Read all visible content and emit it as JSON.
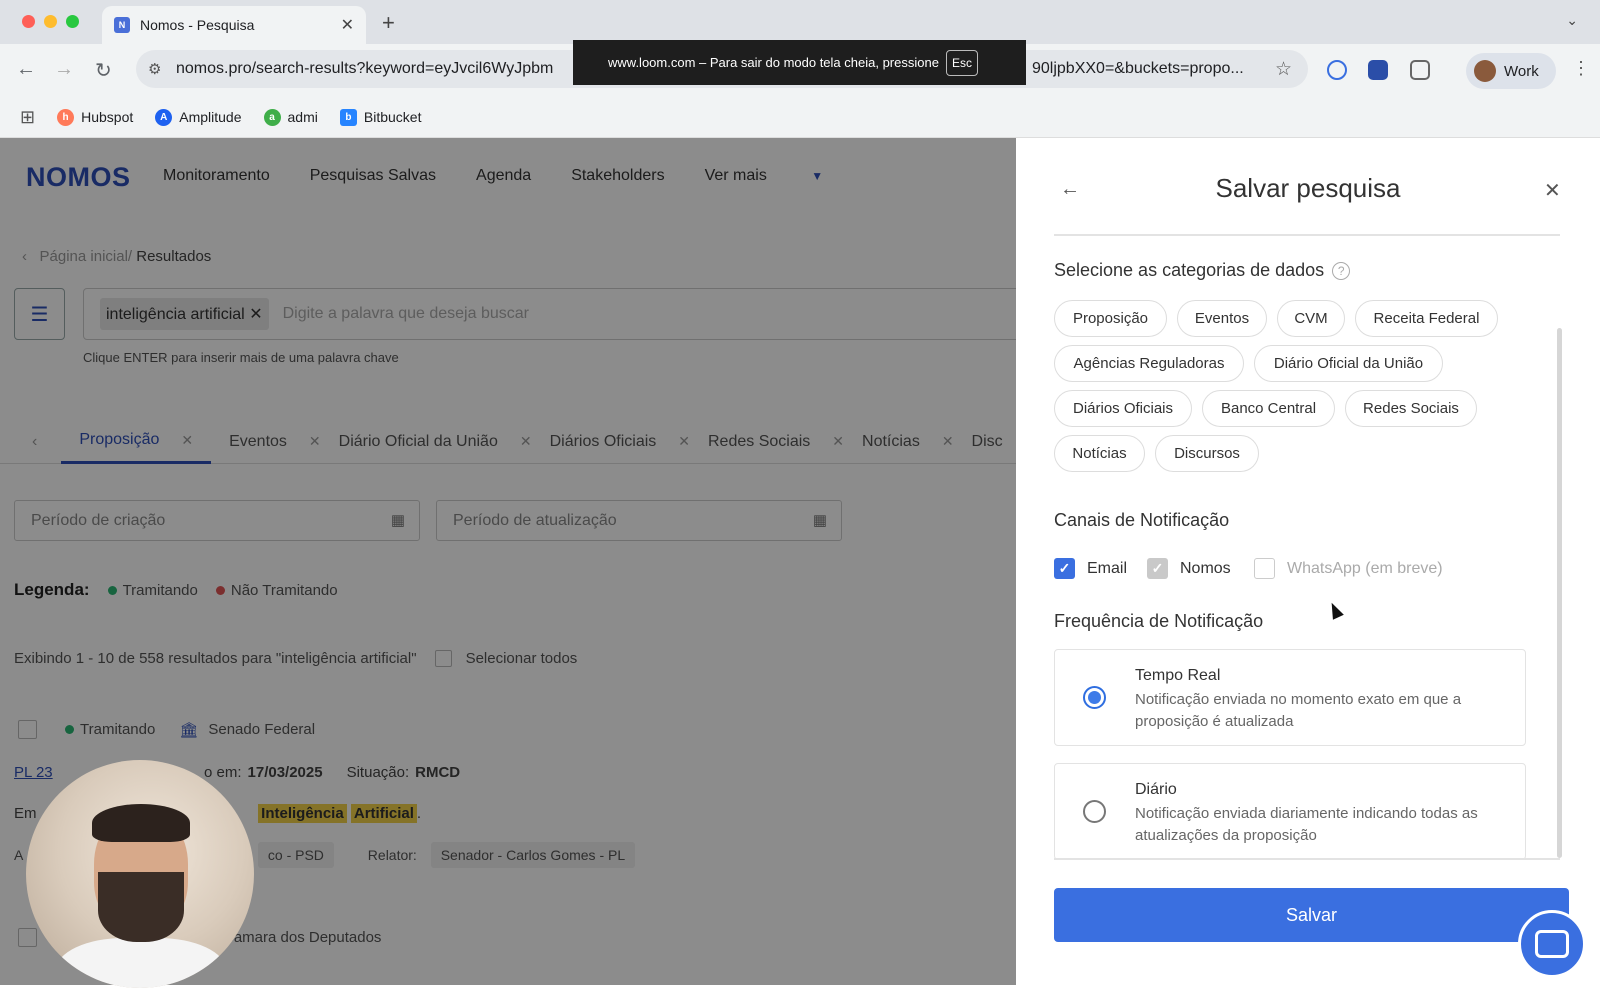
{
  "browser": {
    "tab_title": "Nomos - Pesquisa",
    "url": "nomos.pro/search-results?keyword=eyJvcil6WyJpbm",
    "url_tail": "90ljpbXX0=&buckets=propo...",
    "profile": "Work",
    "fullscreen_notice": "www.loom.com – Para sair do modo tela cheia, pressione",
    "fullscreen_key": "Esc",
    "bookmarks": [
      "Hubspot",
      "Amplitude",
      "admi",
      "Bitbucket"
    ]
  },
  "app": {
    "logo": "NOMOS",
    "nav": [
      "Monitoramento",
      "Pesquisas Salvas",
      "Agenda",
      "Stakeholders",
      "Ver mais"
    ],
    "breadcrumb_home": "Página inicial/",
    "breadcrumb_current": "Resultados",
    "search_chip": "inteligência artificial",
    "search_placeholder": "Digite a palavra que deseja buscar",
    "search_hint": "Clique ENTER para inserir mais de uma palavra chave",
    "result_tabs": [
      "Proposição",
      "Eventos",
      "Diário Oficial da União",
      "Diários Oficiais",
      "Redes Sociais",
      "Notícias",
      "Disc"
    ],
    "date_creation": "Período de criação",
    "date_update": "Período de atualização",
    "legend_label": "Legenda:",
    "legend_tramitando": "Tramitando",
    "legend_nao_tramitando": "Não Tramitando",
    "showing_text": "Exibindo 1 - 10 de 558 resultados para  \"inteligência artificial\"",
    "select_all": "Selecionar todos",
    "result": {
      "status": "Tramitando",
      "house": "Senado Federal",
      "code": "PL 23",
      "date_label": "o em:",
      "date": "17/03/2025",
      "situation_label": "Situação:",
      "situation": "RMCD",
      "ementa_prefix": "Em",
      "highlight_1": "Inteligência",
      "highlight_2": "Artificial",
      "author_prefix": "A",
      "author_tail": "co - PSD",
      "relator_label": "Relator:",
      "relator": "Senador - Carlos Gomes - PL"
    },
    "next_result_house": "Camara dos Deputados"
  },
  "panel": {
    "title": "Salvar pesquisa",
    "categories_label": "Selecione as categorias de dados",
    "categories": [
      "Proposição",
      "Eventos",
      "CVM",
      "Receita Federal",
      "Agências Reguladoras",
      "Diário Oficial da União",
      "Diários Oficiais",
      "Banco Central",
      "Redes Sociais",
      "Notícias",
      "Discursos"
    ],
    "channels_label": "Canais de Notificação",
    "channels": {
      "email": "Email",
      "nomos": "Nomos",
      "whatsapp": "WhatsApp (em breve)"
    },
    "frequency_label": "Frequência de Notificação",
    "frequency": [
      {
        "title": "Tempo Real",
        "desc": "Notificação enviada no momento exato em que a proposição é atualizada"
      },
      {
        "title": "Diário",
        "desc": "Notificação enviada diariamente indicando todas as atualizações da proposição"
      }
    ],
    "save_button": "Salvar"
  },
  "colors": {
    "brand": "#2f4fb8",
    "primary_button": "#3a6fe0",
    "tramitando": "#2bb673",
    "nao_tramitando": "#e05555",
    "highlight": "#f2d24a"
  }
}
